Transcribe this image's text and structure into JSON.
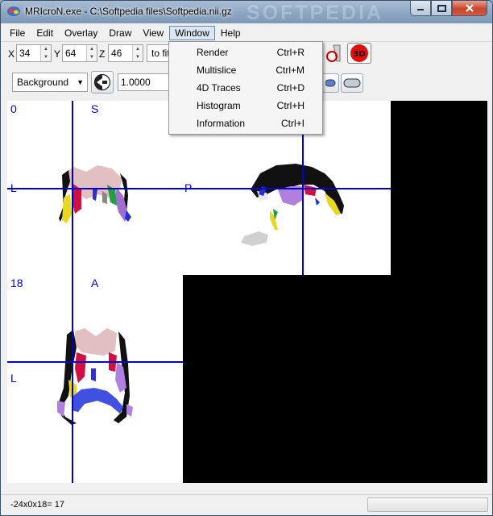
{
  "window": {
    "title": "MRIcroN.exe - C:\\Softpedia files\\Softpedia.nii.gz",
    "watermark": "SOFTPEDIA"
  },
  "menubar": {
    "items": [
      "File",
      "Edit",
      "Overlay",
      "Draw",
      "View",
      "Window",
      "Help"
    ]
  },
  "toolbar1": {
    "x_label": "X",
    "x_value": "34",
    "y_label": "Y",
    "y_value": "64",
    "z_label": "Z",
    "z_value": "46",
    "zoom_value": "to fit",
    "render3d_label": "3D"
  },
  "toolbar2": {
    "layer_select": "Background",
    "opacity_value": "1.0000"
  },
  "window_menu": {
    "items": [
      {
        "label": "Render",
        "shortcut": "Ctrl+R"
      },
      {
        "label": "Multislice",
        "shortcut": "Ctrl+M"
      },
      {
        "label": "4D Traces",
        "shortcut": "Ctrl+D"
      },
      {
        "label": "Histogram",
        "shortcut": "Ctrl+H"
      },
      {
        "label": "Information",
        "shortcut": "Ctrl+I"
      }
    ]
  },
  "viewer": {
    "panel1": {
      "slice": "0",
      "top_label": "S",
      "left_label": "L",
      "right_label": "P"
    },
    "panel3": {
      "slice": "18",
      "top_label": "A",
      "left_label": "L"
    },
    "crosshair_color": "#0000cc"
  },
  "statusbar": {
    "text": "-24x0x18= 17"
  }
}
